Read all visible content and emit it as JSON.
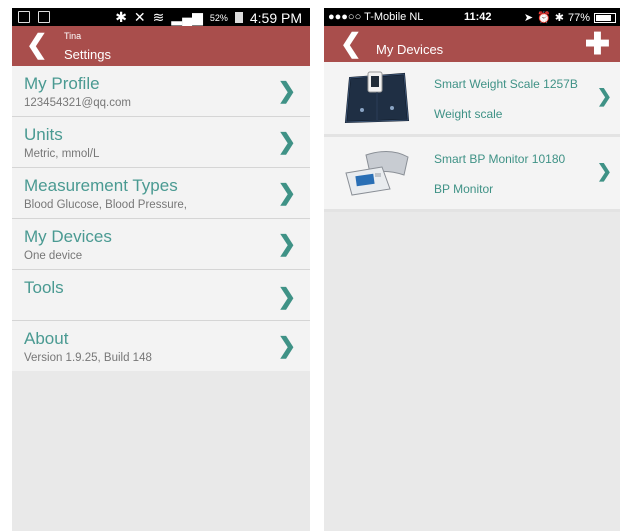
{
  "left": {
    "status": {
      "battery_pct": "52%",
      "time": "4:59 PM"
    },
    "header": {
      "subtitle": "Tina",
      "title": "Settings"
    },
    "items": [
      {
        "title": "My Profile",
        "sub": "123454321@qq.com"
      },
      {
        "title": "Units",
        "sub": "Metric, mmol/L"
      },
      {
        "title": "Measurement Types",
        "sub": "Blood Glucose, Blood Pressure,"
      },
      {
        "title": "My Devices",
        "sub": "One device"
      },
      {
        "title": "Tools",
        "sub": ""
      },
      {
        "title": "About",
        "sub": "Version 1.9.25, Build 148"
      }
    ]
  },
  "right": {
    "status": {
      "carrier": "●●●○○ T-Mobile NL",
      "time": "11:42",
      "battery_pct": "77%"
    },
    "header": {
      "title": "My Devices"
    },
    "devices": [
      {
        "name": "Smart Weight Scale 1257B",
        "type": "Weight scale"
      },
      {
        "name": "Smart BP Monitor 10180",
        "type": "BP Monitor"
      }
    ]
  },
  "colors": {
    "header": "#a94e4c",
    "accent": "#3f9286",
    "background": "#e9e9e9"
  },
  "icons": {
    "back": "chevron-left-icon",
    "add": "plus-icon",
    "row": "chevron-right-icon"
  }
}
